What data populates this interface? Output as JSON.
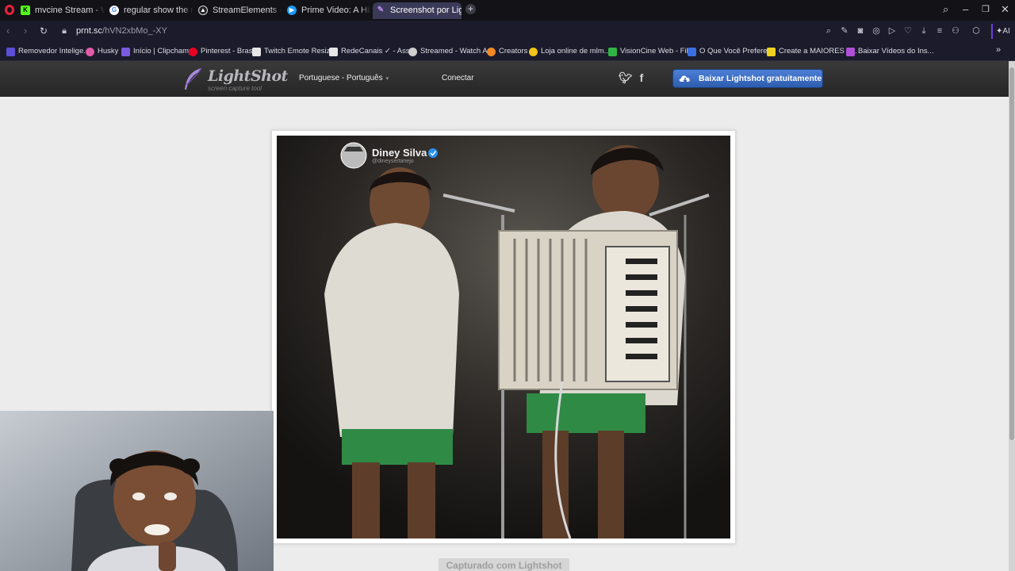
{
  "tabs": [
    {
      "label": "mvcine Stream - Watch Li",
      "icon": "kick-icon",
      "color": "#53fc18"
    },
    {
      "label": "regular show the movie -",
      "icon": "google-icon",
      "color": "#ffffff"
    },
    {
      "label": "StreamElements - Media",
      "icon": "streamelements-icon",
      "color": "#ffffff"
    },
    {
      "label": "Prime Video: A História D",
      "icon": "prime-video-icon",
      "color": "#1a98ff"
    },
    {
      "label": "Screenshot por Lightshot",
      "icon": "lightshot-icon",
      "color": "#9a6fd8",
      "active": true
    }
  ],
  "address": {
    "domain": "prnt.sc",
    "path": "/hVN2xbMo_-XY"
  },
  "bookmarks": [
    {
      "label": "Removedor Intelige...",
      "color": "#5b4fd8"
    },
    {
      "label": "Husky",
      "color": "#e05aa8"
    },
    {
      "label": "Início | Clipchamp",
      "color": "#7a5ae0"
    },
    {
      "label": "Pinterest - Brasil",
      "color": "#e60023"
    },
    {
      "label": "Twitch Emote Resizer",
      "color": "#e6e6e6"
    },
    {
      "label": "RedeCanais ✓ - Ass...",
      "color": "#3da0e6"
    },
    {
      "label": "Streamed - Watch A...",
      "color": "#cfcfcf"
    },
    {
      "label": "Creators",
      "color": "#f08a24"
    },
    {
      "label": "Loja online de mlm...",
      "color": "#f0c419"
    },
    {
      "label": "VisionCine Web - Fil...",
      "color": "#2fb344"
    },
    {
      "label": "O Que Você Prefere...",
      "color": "#3b6fe0"
    },
    {
      "label": "Create a MAIORES L...",
      "color": "#f0d020"
    },
    {
      "label": "Baixar Vídeos do Ins...",
      "color": "#b04fd8"
    }
  ],
  "lightshot": {
    "brand": "LightShot",
    "tagline": "screen capture tool",
    "language": "Portuguese - Português",
    "login": "Conectar",
    "download_button": "Baixar Lightshot gratuitamente",
    "caption": "Capturado com Lightshot"
  },
  "photo": {
    "account_name": "Diney Silva",
    "account_handle": "@dineysertanejo"
  },
  "colors": {
    "tab_bar": "#121217",
    "toolbar": "#1b1b2b",
    "lightshot_header": "#2e2e2e",
    "download_button": "#3b6fc4",
    "page_background": "#ececec"
  }
}
